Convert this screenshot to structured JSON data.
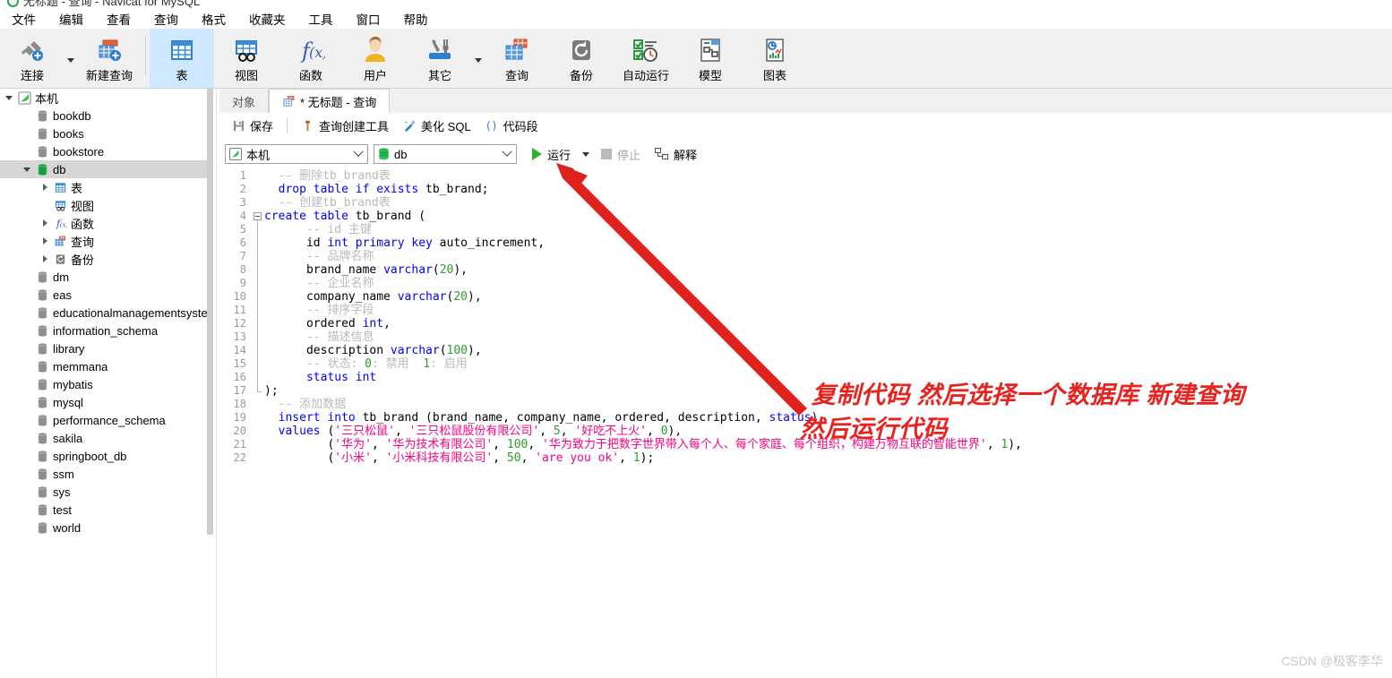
{
  "window": {
    "title": "无标题 - 查询 - Navicat for MySQL",
    "logo_icon": "navicat-logo-icon"
  },
  "menubar": {
    "items": [
      {
        "label": "文件",
        "name": "menu-file"
      },
      {
        "label": "编辑",
        "name": "menu-edit"
      },
      {
        "label": "查看",
        "name": "menu-view"
      },
      {
        "label": "查询",
        "name": "menu-query"
      },
      {
        "label": "格式",
        "name": "menu-format"
      },
      {
        "label": "收藏夹",
        "name": "menu-favorites"
      },
      {
        "label": "工具",
        "name": "menu-tools"
      },
      {
        "label": "窗口",
        "name": "menu-window"
      },
      {
        "label": "帮助",
        "name": "menu-help"
      }
    ]
  },
  "toolbar": {
    "buttons": [
      {
        "label": "连接",
        "icon": "connection-icon",
        "name": "toolbar-connection",
        "selected": false,
        "caret": true
      },
      {
        "label": "新建查询",
        "icon": "new-query-icon",
        "name": "toolbar-new-query",
        "selected": false,
        "caret": false
      },
      {
        "label": "表",
        "icon": "table-icon",
        "name": "toolbar-table",
        "selected": true,
        "caret": false
      },
      {
        "label": "视图",
        "icon": "view-icon",
        "name": "toolbar-view",
        "selected": false,
        "caret": false
      },
      {
        "label": "函数",
        "icon": "function-icon",
        "name": "toolbar-function",
        "selected": false,
        "caret": false
      },
      {
        "label": "用户",
        "icon": "user-icon",
        "name": "toolbar-user",
        "selected": false,
        "caret": false
      },
      {
        "label": "其它",
        "icon": "other-tools-icon",
        "name": "toolbar-other",
        "selected": false,
        "caret": true
      },
      {
        "label": "查询",
        "icon": "query-icon",
        "name": "toolbar-query",
        "selected": false,
        "caret": false
      },
      {
        "label": "备份",
        "icon": "backup-icon",
        "name": "toolbar-backup",
        "selected": false,
        "caret": false
      },
      {
        "label": "自动运行",
        "icon": "automation-icon",
        "name": "toolbar-automation",
        "selected": false,
        "caret": false
      },
      {
        "label": "模型",
        "icon": "model-icon",
        "name": "toolbar-model",
        "selected": false,
        "caret": false
      },
      {
        "label": "图表",
        "icon": "chart-icon",
        "name": "toolbar-chart",
        "selected": false,
        "caret": false
      }
    ]
  },
  "sidebar": {
    "nodes": [
      {
        "label": "本机",
        "icon": "navicat-connection-icon",
        "indent": 0,
        "expander": "down",
        "selected": false
      },
      {
        "label": "bookdb",
        "icon": "database-icon",
        "indent": 1,
        "expander": "none",
        "selected": false
      },
      {
        "label": "books",
        "icon": "database-icon",
        "indent": 1,
        "expander": "none",
        "selected": false
      },
      {
        "label": "bookstore",
        "icon": "database-icon",
        "indent": 1,
        "expander": "none",
        "selected": false
      },
      {
        "label": "db",
        "icon": "database-open-icon",
        "indent": 1,
        "expander": "down",
        "selected": true
      },
      {
        "label": "表",
        "icon": "table-icon",
        "indent": 2,
        "expander": "right",
        "selected": false
      },
      {
        "label": "视图",
        "icon": "view-icon",
        "indent": 2,
        "expander": "none",
        "selected": false
      },
      {
        "label": "函数",
        "icon": "function-icon",
        "indent": 2,
        "expander": "right",
        "selected": false
      },
      {
        "label": "查询",
        "icon": "query-icon",
        "indent": 2,
        "expander": "right",
        "selected": false
      },
      {
        "label": "备份",
        "icon": "backup-icon",
        "indent": 2,
        "expander": "right",
        "selected": false
      },
      {
        "label": "dm",
        "icon": "database-icon",
        "indent": 1,
        "expander": "none",
        "selected": false
      },
      {
        "label": "eas",
        "icon": "database-icon",
        "indent": 1,
        "expander": "none",
        "selected": false
      },
      {
        "label": "educationalmanagementsystem",
        "icon": "database-icon",
        "indent": 1,
        "expander": "none",
        "selected": false
      },
      {
        "label": "information_schema",
        "icon": "database-icon",
        "indent": 1,
        "expander": "none",
        "selected": false
      },
      {
        "label": "library",
        "icon": "database-icon",
        "indent": 1,
        "expander": "none",
        "selected": false
      },
      {
        "label": "memmana",
        "icon": "database-icon",
        "indent": 1,
        "expander": "none",
        "selected": false
      },
      {
        "label": "mybatis",
        "icon": "database-icon",
        "indent": 1,
        "expander": "none",
        "selected": false
      },
      {
        "label": "mysql",
        "icon": "database-icon",
        "indent": 1,
        "expander": "none",
        "selected": false
      },
      {
        "label": "performance_schema",
        "icon": "database-icon",
        "indent": 1,
        "expander": "none",
        "selected": false
      },
      {
        "label": "sakila",
        "icon": "database-icon",
        "indent": 1,
        "expander": "none",
        "selected": false
      },
      {
        "label": "springboot_db",
        "icon": "database-icon",
        "indent": 1,
        "expander": "none",
        "selected": false
      },
      {
        "label": "ssm",
        "icon": "database-icon",
        "indent": 1,
        "expander": "none",
        "selected": false
      },
      {
        "label": "sys",
        "icon": "database-icon",
        "indent": 1,
        "expander": "none",
        "selected": false
      },
      {
        "label": "test",
        "icon": "database-icon",
        "indent": 1,
        "expander": "none",
        "selected": false
      },
      {
        "label": "world",
        "icon": "database-icon",
        "indent": 1,
        "expander": "none",
        "selected": false
      }
    ]
  },
  "tabs": [
    {
      "label": "对象",
      "name": "tab-objects",
      "active": false,
      "icon": null
    },
    {
      "label": "* 无标题 - 查询",
      "name": "tab-untitled-query",
      "active": true,
      "icon": "query-tab-icon"
    }
  ],
  "query_toolbar": {
    "buttons": [
      {
        "label": "保存",
        "icon": "save-icon",
        "name": "save-button"
      },
      {
        "label": "查询创建工具",
        "icon": "query-builder-icon",
        "name": "query-builder-button"
      },
      {
        "label": "美化 SQL",
        "icon": "beautify-sql-icon",
        "name": "beautify-sql-button"
      },
      {
        "label": "代码段",
        "icon": "code-snippet-icon",
        "name": "code-snippet-button"
      }
    ]
  },
  "connection_bar": {
    "connection": {
      "value": "本机",
      "icon": "navicat-connection-icon",
      "name": "connection-select"
    },
    "database": {
      "value": "db",
      "icon": "database-icon",
      "name": "database-select"
    },
    "run": {
      "label": "运行",
      "name": "run-button"
    },
    "stop": {
      "label": "停止",
      "name": "stop-button",
      "enabled": false
    },
    "explain": {
      "label": "解释",
      "name": "explain-button"
    }
  },
  "editor": {
    "line_numbers": [
      1,
      2,
      3,
      4,
      5,
      6,
      7,
      8,
      9,
      10,
      11,
      12,
      13,
      14,
      15,
      16,
      17,
      18,
      19,
      20,
      21,
      22
    ],
    "lines": [
      [
        {
          "t": "  ",
          "c": "pl"
        },
        {
          "t": "-- 删除tb_brand表",
          "c": "cm"
        }
      ],
      [
        {
          "t": "  ",
          "c": "pl"
        },
        {
          "t": "drop table if exists",
          "c": "k"
        },
        {
          "t": " tb_brand;",
          "c": "pl"
        }
      ],
      [
        {
          "t": "  ",
          "c": "pl"
        },
        {
          "t": "-- 创建tb_brand表",
          "c": "cm"
        }
      ],
      [
        {
          "t": "create table",
          "c": "k"
        },
        {
          "t": " tb_brand (",
          "c": "pl"
        }
      ],
      [
        {
          "t": "      ",
          "c": "pl"
        },
        {
          "t": "-- id 主键",
          "c": "cm"
        }
      ],
      [
        {
          "t": "      id ",
          "c": "pl"
        },
        {
          "t": "int primary key",
          "c": "k"
        },
        {
          "t": " auto_increment,",
          "c": "pl"
        }
      ],
      [
        {
          "t": "      ",
          "c": "pl"
        },
        {
          "t": "-- 品牌名称",
          "c": "cm"
        }
      ],
      [
        {
          "t": "      brand_name ",
          "c": "pl"
        },
        {
          "t": "varchar",
          "c": "k"
        },
        {
          "t": "(",
          "c": "pl"
        },
        {
          "t": "20",
          "c": "nm"
        },
        {
          "t": "),",
          "c": "pl"
        }
      ],
      [
        {
          "t": "      ",
          "c": "pl"
        },
        {
          "t": "-- 企业名称",
          "c": "cm"
        }
      ],
      [
        {
          "t": "      company_name ",
          "c": "pl"
        },
        {
          "t": "varchar",
          "c": "k"
        },
        {
          "t": "(",
          "c": "pl"
        },
        {
          "t": "20",
          "c": "nm"
        },
        {
          "t": "),",
          "c": "pl"
        }
      ],
      [
        {
          "t": "      ",
          "c": "pl"
        },
        {
          "t": "-- 排序字段",
          "c": "cm"
        }
      ],
      [
        {
          "t": "      ordered ",
          "c": "pl"
        },
        {
          "t": "int",
          "c": "k"
        },
        {
          "t": ",",
          "c": "pl"
        }
      ],
      [
        {
          "t": "      ",
          "c": "pl"
        },
        {
          "t": "-- 描述信息",
          "c": "cm"
        }
      ],
      [
        {
          "t": "      description ",
          "c": "pl"
        },
        {
          "t": "varchar",
          "c": "k"
        },
        {
          "t": "(",
          "c": "pl"
        },
        {
          "t": "100",
          "c": "nm"
        },
        {
          "t": "),",
          "c": "pl"
        }
      ],
      [
        {
          "t": "      ",
          "c": "pl"
        },
        {
          "t": "-- 状态: ",
          "c": "cm"
        },
        {
          "t": "0",
          "c": "nm"
        },
        {
          "t": ": 禁用  ",
          "c": "cm"
        },
        {
          "t": "1",
          "c": "nm"
        },
        {
          "t": ": 启用",
          "c": "cm"
        }
      ],
      [
        {
          "t": "      ",
          "c": "pl"
        },
        {
          "t": "status int",
          "c": "k"
        }
      ],
      [
        {
          "t": ");",
          "c": "pl"
        }
      ],
      [
        {
          "t": "  ",
          "c": "pl"
        },
        {
          "t": "-- 添加数据",
          "c": "cm"
        }
      ],
      [
        {
          "t": "  ",
          "c": "pl"
        },
        {
          "t": "insert into",
          "c": "k"
        },
        {
          "t": " tb_brand (brand_name, company_name, ordered, description, ",
          "c": "pl"
        },
        {
          "t": "status",
          "c": "k"
        },
        {
          "t": ")",
          "c": "pl"
        }
      ],
      [
        {
          "t": "  ",
          "c": "pl"
        },
        {
          "t": "values",
          "c": "k"
        },
        {
          "t": " (",
          "c": "pl"
        },
        {
          "t": "'三只松鼠'",
          "c": "st"
        },
        {
          "t": ", ",
          "c": "pl"
        },
        {
          "t": "'三只松鼠股份有限公司'",
          "c": "st"
        },
        {
          "t": ", ",
          "c": "pl"
        },
        {
          "t": "5",
          "c": "nm"
        },
        {
          "t": ", ",
          "c": "pl"
        },
        {
          "t": "'好吃不上火'",
          "c": "st"
        },
        {
          "t": ", ",
          "c": "pl"
        },
        {
          "t": "0",
          "c": "nm"
        },
        {
          "t": "),",
          "c": "pl"
        }
      ],
      [
        {
          "t": "         (",
          "c": "pl"
        },
        {
          "t": "'华为'",
          "c": "st"
        },
        {
          "t": ", ",
          "c": "pl"
        },
        {
          "t": "'华为技术有限公司'",
          "c": "st"
        },
        {
          "t": ", ",
          "c": "pl"
        },
        {
          "t": "100",
          "c": "nm"
        },
        {
          "t": ", ",
          "c": "pl"
        },
        {
          "t": "'华为致力于把数字世界带入每个人、每个家庭、每个组织，构建万物互联的智能世界'",
          "c": "st"
        },
        {
          "t": ", ",
          "c": "pl"
        },
        {
          "t": "1",
          "c": "nm"
        },
        {
          "t": "),",
          "c": "pl"
        }
      ],
      [
        {
          "t": "         (",
          "c": "pl"
        },
        {
          "t": "'小米'",
          "c": "st"
        },
        {
          "t": ", ",
          "c": "pl"
        },
        {
          "t": "'小米科技有限公司'",
          "c": "st"
        },
        {
          "t": ", ",
          "c": "pl"
        },
        {
          "t": "50",
          "c": "nm"
        },
        {
          "t": ", ",
          "c": "pl"
        },
        {
          "t": "'are you ok'",
          "c": "st"
        },
        {
          "t": ", ",
          "c": "pl"
        },
        {
          "t": "1",
          "c": "nm"
        },
        {
          "t": ");",
          "c": "pl"
        }
      ]
    ],
    "fold_start_line": 4,
    "fold_end_line": 17
  },
  "annotations": {
    "color": "#e8231f",
    "text_line1": "复制代码 然后选择一个数据库 新建查询",
    "text_line2": "然后运行代码",
    "arrow_name": "red-arrow-to-run-button"
  },
  "watermark": "CSDN @极客李华"
}
